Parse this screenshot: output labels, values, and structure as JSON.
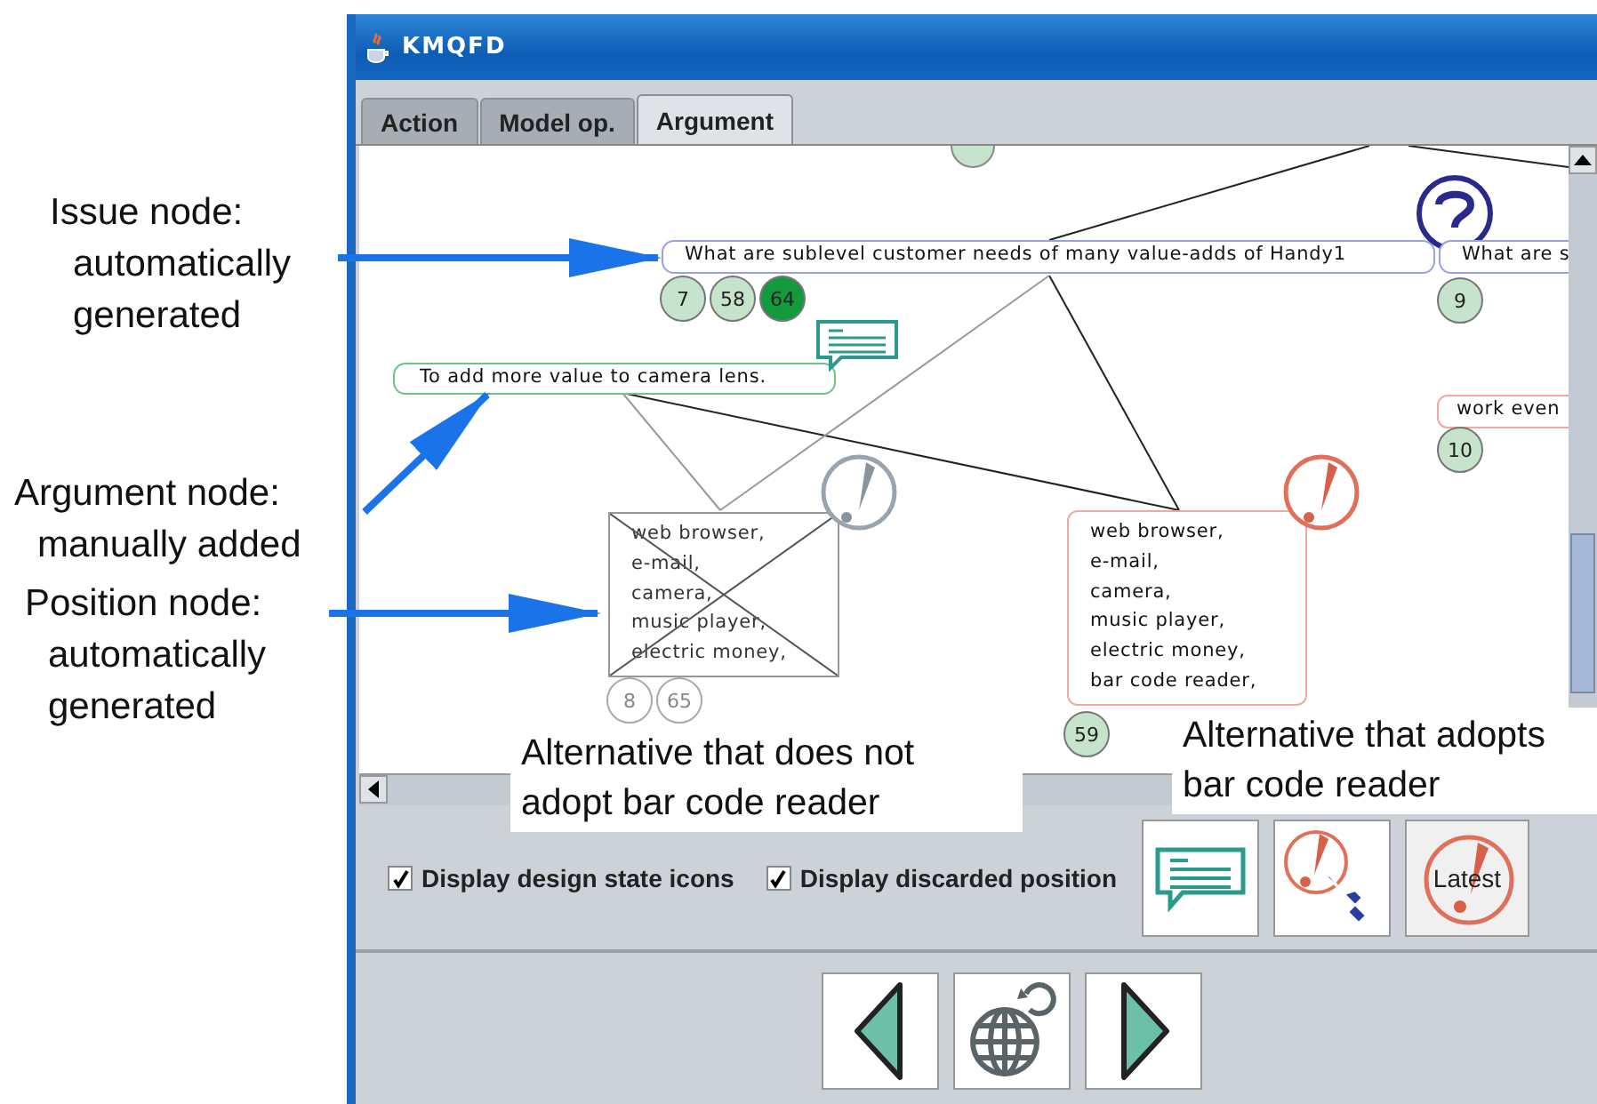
{
  "annotations": [
    {
      "lines": [
        "Issue node:",
        "automatically",
        "generated"
      ]
    },
    {
      "lines": [
        "Argument node:",
        "manually added"
      ]
    },
    {
      "lines": [
        "Position node:",
        "automatically",
        "generated"
      ]
    }
  ],
  "window": {
    "title": "KMQFD"
  },
  "tabs": [
    {
      "label": "Action",
      "selected": false
    },
    {
      "label": "Model op.",
      "selected": false
    },
    {
      "label": "Argument",
      "selected": true
    }
  ],
  "canvas": {
    "nodes": [
      {
        "kind": "issue",
        "lines": [
          "What are sublevel customer needs of many value-adds of Handy1"
        ],
        "discarded": false,
        "badges": [
          {
            "label": "7",
            "color": "#c6e4cb"
          },
          {
            "label": "58",
            "color": "#c6e4cb"
          },
          {
            "label": "64",
            "color": "#129a3c"
          }
        ]
      },
      {
        "kind": "issue",
        "lines": [
          "What are s"
        ],
        "discarded": false,
        "badges": [
          {
            "label": "9",
            "color": "#c6e4cb"
          }
        ]
      },
      {
        "kind": "argument",
        "lines": [
          "To add more value to camera lens."
        ],
        "discarded": false
      },
      {
        "kind": "position",
        "lines": [
          "work even"
        ],
        "discarded": false,
        "badges": [
          {
            "label": "10",
            "color": "#c6e4cb"
          }
        ]
      },
      {
        "kind": "position",
        "lines": [
          "web browser,",
          "e-mail,",
          "camera,",
          "music player,",
          "electric money,"
        ],
        "discarded": true,
        "badges": [
          {
            "label": "8",
            "color": "#ffffff"
          },
          {
            "label": "65",
            "color": "#ffffff"
          }
        ]
      },
      {
        "kind": "position",
        "lines": [
          "web browser,",
          "e-mail,",
          "camera,",
          "music player,",
          "electric money,",
          "bar code reader,"
        ],
        "discarded": false,
        "badges": [
          {
            "label": "59",
            "color": "#c6e4cb"
          }
        ]
      }
    ]
  },
  "callouts": [
    {
      "lines": [
        "Alternative that does not",
        "adopt bar code reader"
      ]
    },
    {
      "lines": [
        "Alternative that adopts",
        "bar code reader"
      ]
    }
  ],
  "options": [
    {
      "label": "Display design state icons",
      "checked": true
    },
    {
      "label": "Display discarded position",
      "checked": true
    }
  ],
  "tool_buttons": [
    {
      "kind": "comment"
    },
    {
      "kind": "point"
    },
    {
      "kind": "latest",
      "label": "Latest"
    }
  ],
  "nav_buttons": [
    {
      "kind": "back"
    },
    {
      "kind": "globe"
    },
    {
      "kind": "forward"
    }
  ]
}
